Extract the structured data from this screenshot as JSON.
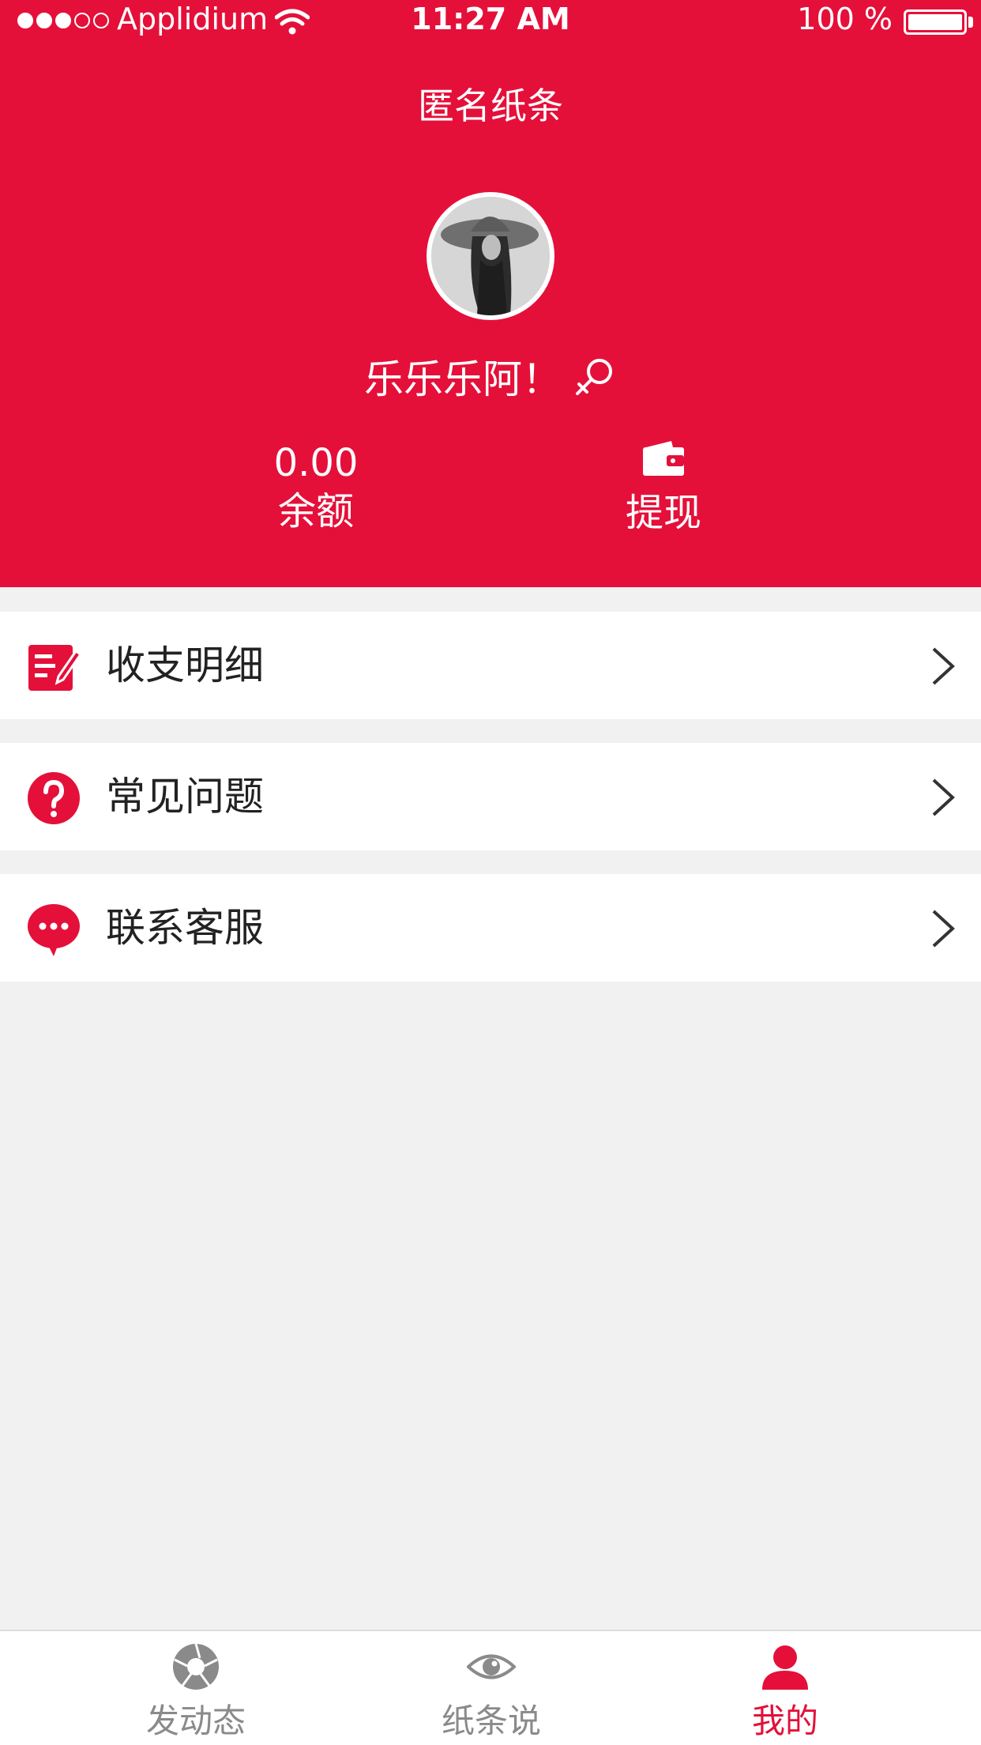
{
  "status_bar": {
    "carrier": "Applidium",
    "time": "11:27 AM",
    "battery": "100 %"
  },
  "header": {
    "title": "匿名纸条",
    "username": "乐乐乐阿！",
    "gender_icon": "female-icon",
    "balance_value": "0.00",
    "balance_label": "余额",
    "withdraw_label": "提现",
    "background_color": "#e4103a"
  },
  "menu": {
    "items": [
      {
        "label": "收支明细",
        "icon": "ledger-edit-icon"
      },
      {
        "label": "常见问题",
        "icon": "question-icon"
      },
      {
        "label": "联系客服",
        "icon": "chat-bubble-icon"
      }
    ]
  },
  "tabbar": {
    "tabs": [
      {
        "label": "发动态",
        "icon": "aperture-icon",
        "active": false
      },
      {
        "label": "纸条说",
        "icon": "eye-icon",
        "active": false
      },
      {
        "label": "我的",
        "icon": "user-icon",
        "active": true
      }
    ],
    "active_color": "#e4103a",
    "inactive_color": "#8a8a8a"
  }
}
